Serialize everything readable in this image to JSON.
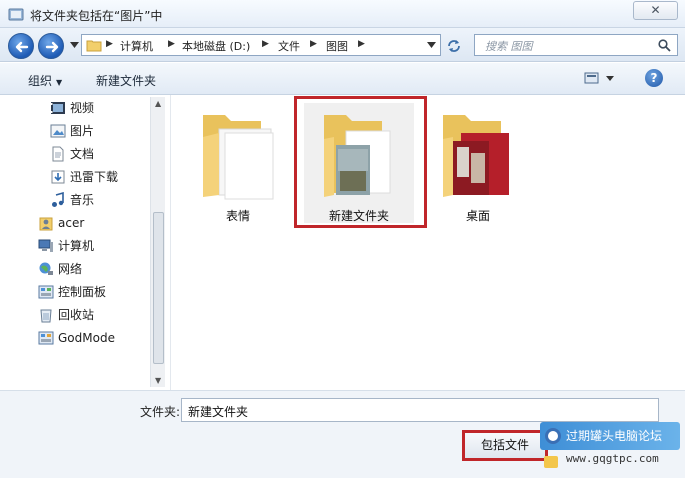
{
  "window": {
    "title": "将文件夹包括在“图片”中",
    "close_glyph": "✕"
  },
  "address_bar": {
    "crumbs": [
      "计算机",
      "本地磁盘 (D:)",
      "文件",
      "图图"
    ],
    "search_placeholder": "搜索 图图"
  },
  "toolbar": {
    "organize_label": "组织",
    "new_folder_label": "新建文件夹",
    "help_glyph": "?"
  },
  "navigation": {
    "items": [
      {
        "label": "视频",
        "icon": "video-icon"
      },
      {
        "label": "图片",
        "icon": "pictures-icon"
      },
      {
        "label": "文档",
        "icon": "documents-icon"
      },
      {
        "label": "迅雷下载",
        "icon": "download-icon"
      },
      {
        "label": "音乐",
        "icon": "music-icon"
      },
      {
        "label": "acer",
        "icon": "user-icon"
      },
      {
        "label": "计算机",
        "icon": "computer-icon"
      },
      {
        "label": "网络",
        "icon": "network-icon"
      },
      {
        "label": "控制面板",
        "icon": "control-panel-icon"
      },
      {
        "label": "回收站",
        "icon": "recycle-bin-icon"
      },
      {
        "label": "GodMode",
        "icon": "godmode-icon"
      }
    ],
    "selected": "计算机"
  },
  "folders": [
    {
      "label": "表情",
      "icon": "folder-icon"
    },
    {
      "label": "新建文件夹",
      "icon": "folder-icon",
      "selected": true,
      "highlighted": true
    },
    {
      "label": "桌面",
      "icon": "folder-icon"
    }
  ],
  "bottom": {
    "folder_field_label": "文件夹:",
    "folder_field_value": "新建文件夹",
    "include_button_label": "包括文件",
    "watermark_text": "过期罐头电脑论坛",
    "watermark_url": "www.gqgtpc.com"
  },
  "colors": {
    "highlight_red": "#c0262a",
    "accent_blue": "#1e5bb5"
  }
}
